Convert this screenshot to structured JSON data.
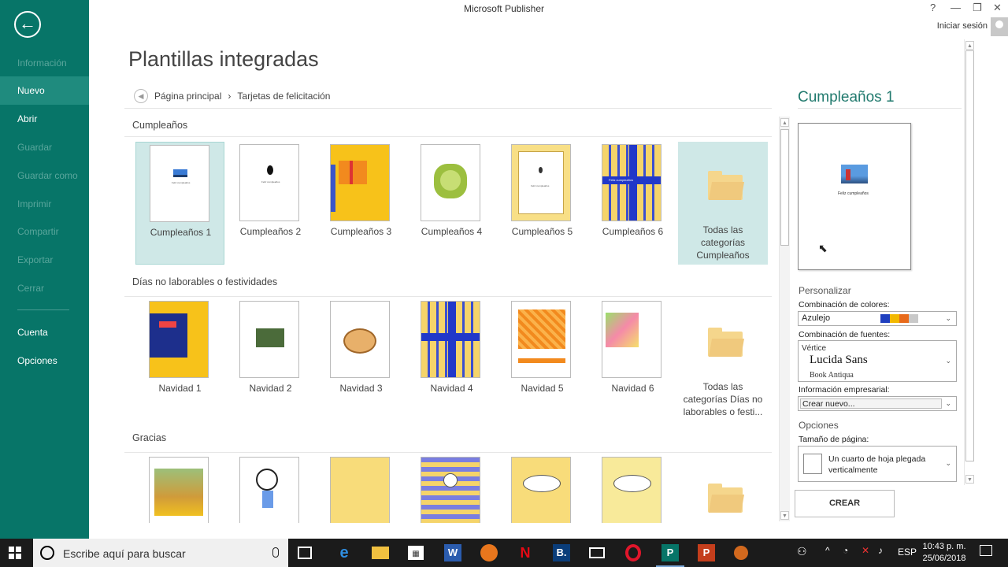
{
  "app": {
    "title": "Microsoft Publisher",
    "signin": "Iniciar sesión",
    "help": "?",
    "minimize": "—",
    "restore": "❐",
    "close": "✕"
  },
  "sidebar": {
    "items": [
      {
        "label": "Información"
      },
      {
        "label": "Nuevo"
      },
      {
        "label": "Abrir"
      },
      {
        "label": "Guardar"
      },
      {
        "label": "Guardar como"
      },
      {
        "label": "Imprimir"
      },
      {
        "label": "Compartir"
      },
      {
        "label": "Exportar"
      },
      {
        "label": "Cerrar"
      },
      {
        "label": "Cuenta"
      },
      {
        "label": "Opciones"
      }
    ]
  },
  "main": {
    "title": "Plantillas integradas",
    "breadcrumb": {
      "home": "Página principal",
      "sep": "›",
      "current": "Tarjetas de felicitación"
    }
  },
  "sections": [
    {
      "title": "Cumpleaños",
      "tiles": [
        "Cumpleaños 1",
        "Cumpleaños 2",
        "Cumpleaños 3",
        "Cumpleaños 4",
        "Cumpleaños 5",
        "Cumpleaños 6"
      ],
      "all_label": "Todas las categorías Cumpleaños"
    },
    {
      "title": "Días no laborables o festividades",
      "tiles": [
        "Navidad 1",
        "Navidad 2",
        "Navidad 3",
        "Navidad 4",
        "Navidad 5",
        "Navidad 6"
      ],
      "all_label": "Todas las categorías Días no laborables o festi..."
    },
    {
      "title": "Gracias",
      "tiles": [
        "",
        "",
        "",
        "",
        "",
        ""
      ],
      "all_label": ""
    }
  ],
  "panel": {
    "title": "Cumpleaños 1",
    "personalize": "Personalizar",
    "color_label": "Combinación de colores:",
    "color_value": "Azulejo",
    "color_swatches": [
      "#1f3fbf",
      "#f2b800",
      "#e86a1a",
      "#c9c9c9"
    ],
    "font_label": "Combinación de fuentes:",
    "font_name": "Vértice",
    "font_primary": "Lucida Sans",
    "font_secondary": "Book Antiqua",
    "business_label": "Información empresarial:",
    "business_value": "Crear nuevo...",
    "options": "Opciones",
    "page_size_label": "Tamaño de página:",
    "page_size_value": "Un cuarto de hoja plegada verticalmente",
    "create": "CREAR"
  },
  "taskbar": {
    "search_placeholder": "Escribe aquí para buscar",
    "language": "ESP",
    "time": "10:43 p. m.",
    "date": "25/06/2018",
    "app_letters": {
      "word": "W",
      "booking": "B.",
      "publisher": "P",
      "powerpoint": "P"
    }
  }
}
